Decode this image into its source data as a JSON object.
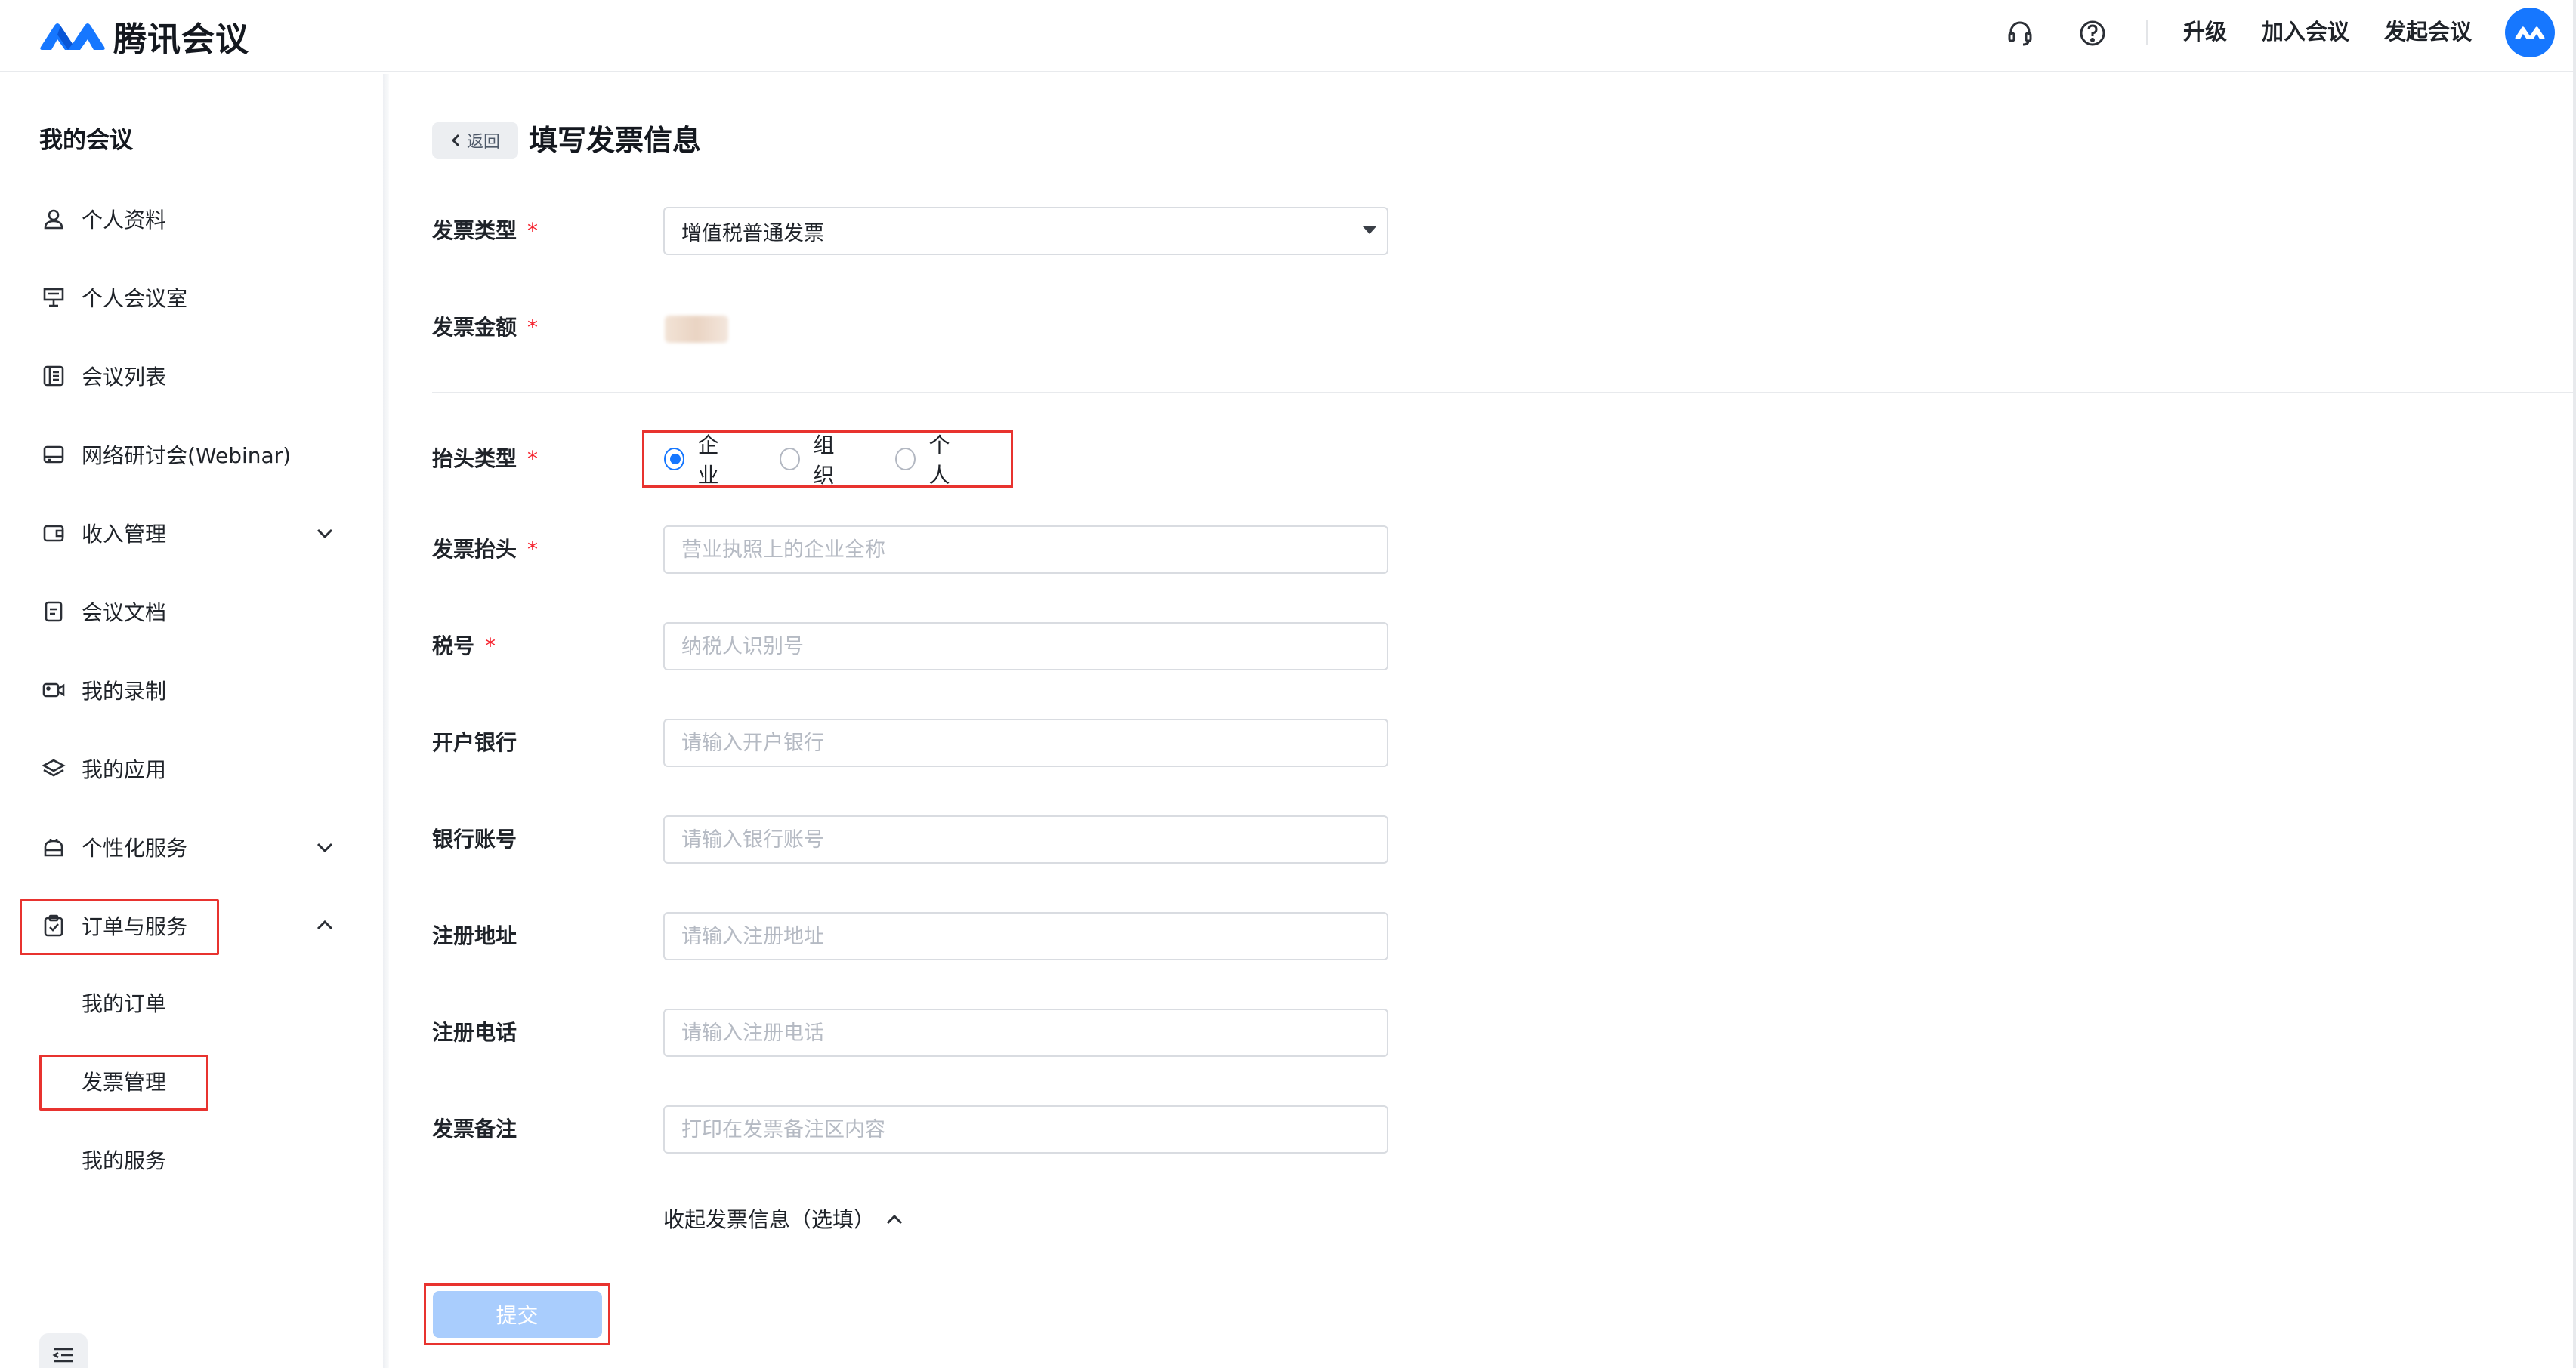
{
  "header": {
    "app_name": "腾讯会议",
    "links": {
      "upgrade": "升级",
      "join": "加入会议",
      "start": "发起会议"
    },
    "icons": [
      "headset-icon",
      "help-icon"
    ],
    "accent": "#1677ff"
  },
  "sidebar": {
    "title": "我的会议",
    "items": [
      {
        "label": "个人资料",
        "icon": "user-icon"
      },
      {
        "label": "个人会议室",
        "icon": "podium-icon"
      },
      {
        "label": "会议列表",
        "icon": "list-icon"
      },
      {
        "label": "网络研讨会(Webinar)",
        "icon": "webinar-icon"
      },
      {
        "label": "收入管理",
        "icon": "wallet-icon",
        "expandable": true
      },
      {
        "label": "会议文档",
        "icon": "document-icon"
      },
      {
        "label": "我的录制",
        "icon": "video-icon"
      },
      {
        "label": "我的应用",
        "icon": "layers-icon"
      },
      {
        "label": "个性化服务",
        "icon": "personalize-icon",
        "expandable": true
      },
      {
        "label": "订单与服务",
        "icon": "clipboard-icon",
        "expanded": true
      }
    ],
    "sub_items": [
      "我的订单",
      "发票管理",
      "我的服务"
    ],
    "active_sub": "发票管理"
  },
  "main": {
    "back_label": "返回",
    "title": "填写发票信息",
    "invoice_type": {
      "label": "发票类型",
      "value": "增值税普通发票"
    },
    "invoice_amount": {
      "label": "发票金额"
    },
    "title_type": {
      "label": "抬头类型",
      "options": [
        "企业",
        "组织",
        "个人"
      ],
      "selected": "企业"
    },
    "invoice_title": {
      "label": "发票抬头",
      "placeholder": "营业执照上的企业全称"
    },
    "tax_no": {
      "label": "税号",
      "placeholder": "纳税人识别号"
    },
    "bank": {
      "label": "开户银行",
      "placeholder": "请输入开户银行"
    },
    "account": {
      "label": "银行账号",
      "placeholder": "请输入银行账号"
    },
    "address": {
      "label": "注册地址",
      "placeholder": "请输入注册地址"
    },
    "phone": {
      "label": "注册电话",
      "placeholder": "请输入注册电话"
    },
    "note": {
      "label": "发票备注",
      "placeholder": "打印在发票备注区内容"
    },
    "collapse_label": "收起发票信息（选填）",
    "submit_label": "提交",
    "required_mark": "*"
  },
  "colors": {
    "required": "#f5222d",
    "highlight_box": "#e8332f",
    "submit_disabled": "#a9cdfd"
  }
}
